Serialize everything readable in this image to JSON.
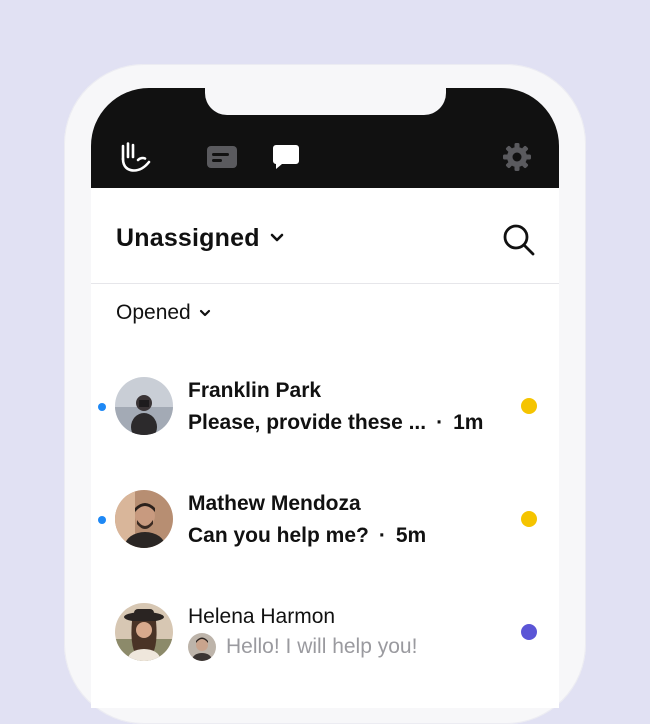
{
  "tabbar": {
    "icons": [
      "hand-icon",
      "card-icon",
      "chat-icon",
      "gear-icon"
    ],
    "active": "chat-icon"
  },
  "header": {
    "title": "Unassigned",
    "search_icon": "search-icon"
  },
  "filter": {
    "label": "Opened"
  },
  "conversations": [
    {
      "name": "Franklin Park",
      "message": "Please, provide these ...",
      "time": "1m",
      "unread": true,
      "status_color": "#f5c400"
    },
    {
      "name": "Mathew Mendoza",
      "message": "Can you help me?",
      "time": "5m",
      "unread": true,
      "status_color": "#f5c400"
    },
    {
      "name": "Helena Harmon",
      "message": "Hello! I will help you!",
      "time": "",
      "unread": false,
      "status_color": "#5b55d6"
    }
  ],
  "colors": {
    "background": "#e1e1f3",
    "topbar": "#111111",
    "unread_dot": "#1e88f5",
    "text_muted": "#9a9a9f"
  },
  "sep": "·"
}
